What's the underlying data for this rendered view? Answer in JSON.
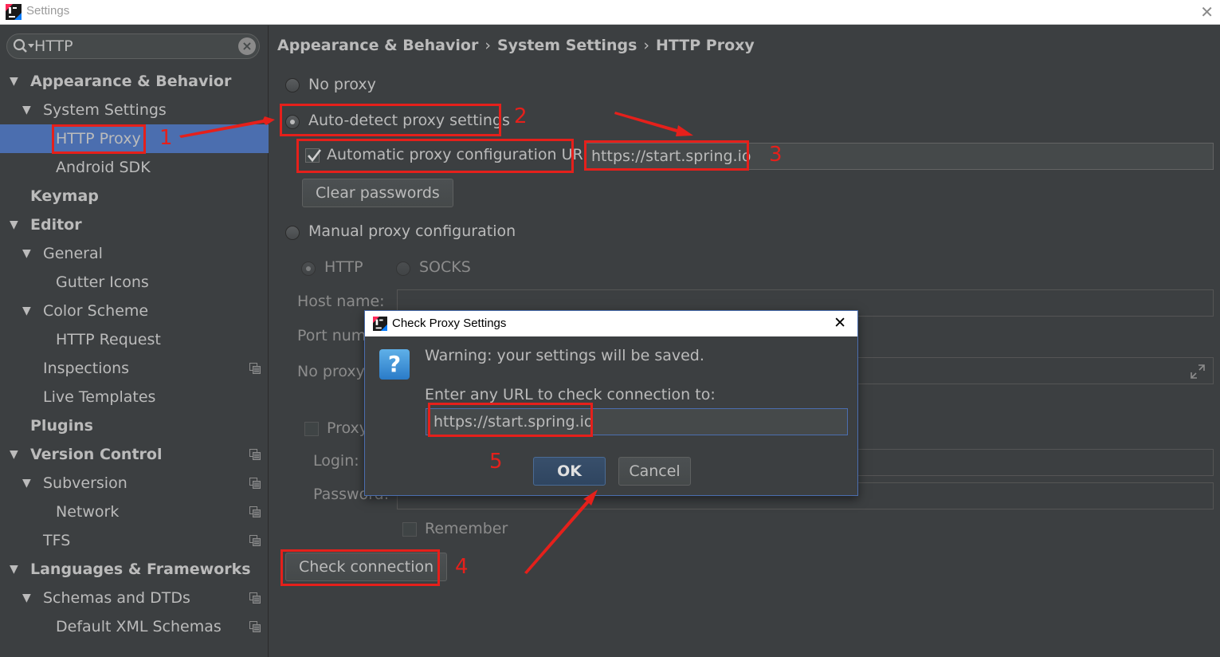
{
  "window": {
    "title": "Settings",
    "close_symbol": "✕"
  },
  "search": {
    "value": "HTTP"
  },
  "sidebar": {
    "items": [
      {
        "label": "Appearance & Behavior",
        "bold": true,
        "level": 0,
        "expanded": true
      },
      {
        "label": "System Settings",
        "bold": false,
        "level": 1,
        "expanded": true
      },
      {
        "label": "HTTP Proxy",
        "bold": false,
        "level": 2,
        "selected": true
      },
      {
        "label": "Android SDK",
        "bold": false,
        "level": 2
      },
      {
        "label": "Keymap",
        "bold": true,
        "level": 0
      },
      {
        "label": "Editor",
        "bold": true,
        "level": 0,
        "expanded": true
      },
      {
        "label": "General",
        "bold": false,
        "level": 1,
        "expanded": true
      },
      {
        "label": "Gutter Icons",
        "bold": false,
        "level": 2
      },
      {
        "label": "Color Scheme",
        "bold": false,
        "level": 1,
        "expanded": true
      },
      {
        "label": "HTTP Request",
        "bold": false,
        "level": 2
      },
      {
        "label": "Inspections",
        "bold": false,
        "level": 1,
        "project_icon": true
      },
      {
        "label": "Live Templates",
        "bold": false,
        "level": 1
      },
      {
        "label": "Plugins",
        "bold": true,
        "level": 0
      },
      {
        "label": "Version Control",
        "bold": true,
        "level": 0,
        "expanded": true,
        "project_icon": true
      },
      {
        "label": "Subversion",
        "bold": false,
        "level": 1,
        "expanded": true,
        "project_icon": true
      },
      {
        "label": "Network",
        "bold": false,
        "level": 2,
        "project_icon": true
      },
      {
        "label": "TFS",
        "bold": false,
        "level": 1,
        "project_icon": true
      },
      {
        "label": "Languages & Frameworks",
        "bold": true,
        "level": 0,
        "expanded": true
      },
      {
        "label": "Schemas and DTDs",
        "bold": false,
        "level": 1,
        "expanded": true,
        "project_icon": true
      },
      {
        "label": "Default XML Schemas",
        "bold": false,
        "level": 2,
        "project_icon": true
      }
    ]
  },
  "breadcrumb": {
    "parts": [
      "Appearance & Behavior",
      "System Settings",
      "HTTP Proxy"
    ],
    "separator": "›"
  },
  "proxy": {
    "no_proxy_label": "No proxy",
    "auto_detect_label": "Auto-detect proxy settings",
    "auto_config_url_label": "Automatic proxy configuration URL:",
    "auto_config_url_value": "https://start.spring.io",
    "clear_passwords_label": "Clear passwords",
    "manual_label": "Manual proxy configuration",
    "http_label": "HTTP",
    "socks_label": "SOCKS",
    "host_name_label": "Host name:",
    "port_number_label": "Port numl",
    "no_proxy_for_label": "No proxy",
    "proxy_auth_label": "Proxy",
    "login_label": "Login:",
    "password_label": "Password:",
    "remember_label": "Remember",
    "check_connection_label": "Check connection"
  },
  "dialog": {
    "title": "Check Proxy Settings",
    "close_symbol": "✕",
    "warning": "Warning: your settings will be saved.",
    "prompt": "Enter any URL to check connection to:",
    "url_value": "https://start.spring.io",
    "ok_label": "OK",
    "cancel_label": "Cancel",
    "question_symbol": "?"
  },
  "annotations": {
    "numbers": [
      "1",
      "2",
      "3",
      "4",
      "5"
    ],
    "color": "#e5201b"
  },
  "colors": {
    "selection": "#4b6eaf",
    "background": "#3c3f41",
    "accent_red": "#e5201b"
  }
}
